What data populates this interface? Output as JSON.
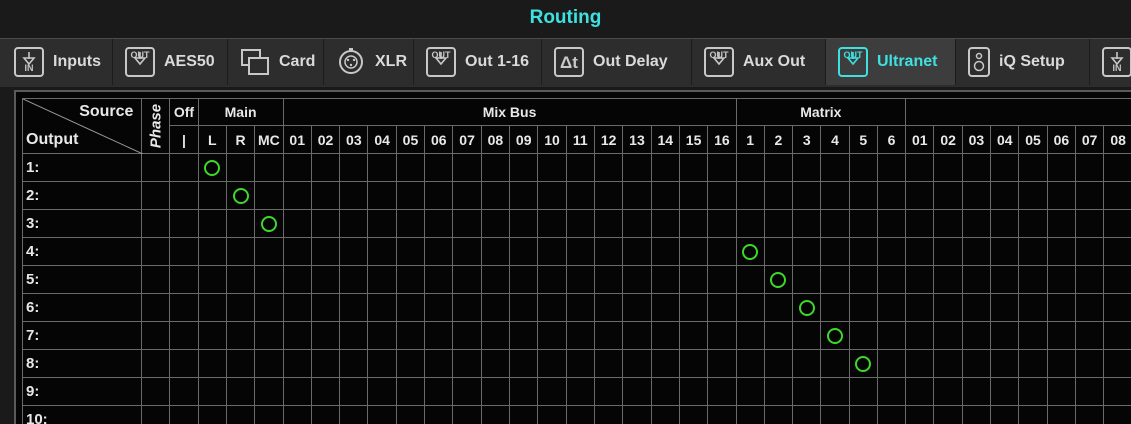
{
  "header": {
    "title": "Routing"
  },
  "tabs": [
    {
      "label": "Inputs",
      "icon": "in-icon",
      "icon_text": "IN",
      "active": false
    },
    {
      "label": "AES50",
      "icon": "out-icon",
      "icon_text": "OUT",
      "active": false
    },
    {
      "label": "Card",
      "icon": "card-icon",
      "icon_text": "",
      "active": false
    },
    {
      "label": "XLR",
      "icon": "xlr-icon",
      "icon_text": "",
      "active": false
    },
    {
      "label": "Out 1-16",
      "icon": "out-icon",
      "icon_text": "OUT",
      "active": false
    },
    {
      "label": "Out Delay",
      "icon": "delay-icon",
      "icon_text": "Δt",
      "active": false
    },
    {
      "label": "Aux Out",
      "icon": "out-icon",
      "icon_text": "OUT",
      "active": false
    },
    {
      "label": "Ultranet",
      "icon": "out-icon",
      "icon_text": "OUT",
      "active": true
    },
    {
      "label": "iQ Setup",
      "icon": "speaker-icon",
      "icon_text": "",
      "active": false
    },
    {
      "label": "",
      "icon": "in-icon",
      "icon_text": "IN",
      "active": false
    }
  ],
  "grid": {
    "corner_source": "Source",
    "corner_output": "Output",
    "phase_label": "Phase",
    "groups": [
      {
        "label": "Off",
        "cols": [
          "|"
        ]
      },
      {
        "label": "Main",
        "cols": [
          "L",
          "R",
          "MC"
        ]
      },
      {
        "label": "Mix Bus",
        "cols": [
          "01",
          "02",
          "03",
          "04",
          "05",
          "06",
          "07",
          "08",
          "09",
          "10",
          "11",
          "12",
          "13",
          "14",
          "15",
          "16"
        ]
      },
      {
        "label": "Matrix",
        "cols": [
          "1",
          "2",
          "3",
          "4",
          "5",
          "6"
        ]
      },
      {
        "label": "",
        "cols": [
          "01",
          "02",
          "03",
          "04",
          "05",
          "06",
          "07",
          "08"
        ]
      }
    ],
    "rows": [
      "1:",
      "2:",
      "3:",
      "4:",
      "5:",
      "6:",
      "7:",
      "8:",
      "9:",
      "10:"
    ],
    "routes": [
      {
        "row": 0,
        "col": 1
      },
      {
        "row": 1,
        "col": 2
      },
      {
        "row": 2,
        "col": 3
      },
      {
        "row": 3,
        "col": 20
      },
      {
        "row": 4,
        "col": 21
      },
      {
        "row": 5,
        "col": 22
      },
      {
        "row": 6,
        "col": 23
      },
      {
        "row": 7,
        "col": 24
      }
    ]
  },
  "colors": {
    "accent": "#3fe0e0",
    "route_dot": "#3fd82a"
  }
}
